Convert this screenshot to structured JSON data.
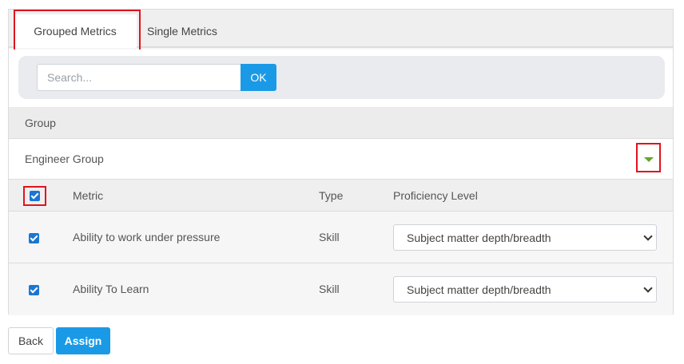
{
  "tabs": [
    {
      "label": "Grouped Metrics",
      "active": true
    },
    {
      "label": "Single Metrics",
      "active": false
    }
  ],
  "search": {
    "placeholder": "Search...",
    "value": "",
    "button_label": "OK"
  },
  "group_section": {
    "header": "Group",
    "group_name": "Engineer Group",
    "expand_icon": "triangle-down-icon"
  },
  "metrics_table": {
    "columns": [
      "Metric",
      "Type",
      "Proficiency Level"
    ],
    "select_all_checked": true,
    "rows": [
      {
        "checked": true,
        "metric": "Ability to work under pressure",
        "type": "Skill",
        "proficiency": "Subject matter depth/breadth"
      },
      {
        "checked": true,
        "metric": "Ability To Learn",
        "type": "Skill",
        "proficiency": "Subject matter depth/breadth"
      }
    ]
  },
  "actions": {
    "back_label": "Back",
    "assign_label": "Assign"
  },
  "colors": {
    "primary": "#1a9ae6",
    "checkbox": "#1a76d2",
    "highlight": "#e0131d",
    "arrow": "#5fa82a"
  }
}
